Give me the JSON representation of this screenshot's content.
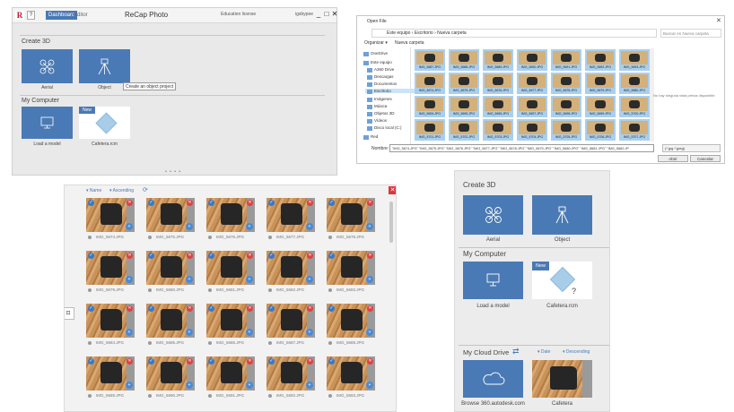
{
  "panel1": {
    "help_label": "?",
    "tabs": [
      "Dashboard",
      "Editor"
    ],
    "app_title": "ReCap Photo",
    "license": "Education license",
    "user": "igsbypee",
    "window_controls": [
      "_",
      "□",
      "✕"
    ],
    "create3d": {
      "heading": "Create 3D",
      "tiles": [
        {
          "label": "Aerial",
          "icon": "drone-icon"
        },
        {
          "label": "Object",
          "icon": "tripod-icon"
        }
      ],
      "tooltip": "Create an object project"
    },
    "mycomputer": {
      "heading": "My Computer",
      "tiles": [
        {
          "label": "Load a model",
          "icon": "monitor-icon"
        },
        {
          "label": "Cafetera.rcm",
          "badge": "New"
        }
      ]
    },
    "pager": "• • • •"
  },
  "panel2": {
    "title": "Open File",
    "address": "Este equipo  ›  Escritorio  ›  Nueva carpeta",
    "search_placeholder": "Buscar en Nueva carpeta",
    "toolbar": {
      "organize": "Organizar ▾",
      "new_folder": "Nueva carpeta"
    },
    "tree": [
      "OneDrive",
      "Este equipo",
      "A360 Drive",
      "Descargas",
      "Documentos",
      "Escritorio",
      "Imágenes",
      "Música",
      "Objetos 3D",
      "Vídeos",
      "Disco local (C:)",
      "Red"
    ],
    "files": [
      "IMG_5687.JPG",
      "IMG_5688.JPG",
      "IMG_5689.JPG",
      "IMG_5690.JPG",
      "IMG_5691.JPG",
      "IMG_5692.JPG",
      "IMG_5693.JPG",
      "IMG_5674.JPG",
      "IMG_5675.JPG",
      "IMG_5676.JPG",
      "IMG_5677.JPG",
      "IMG_5678.JPG",
      "IMG_5679.JPG",
      "IMG_5680.JPG",
      "IMG_5694.JPG",
      "IMG_5695.JPG",
      "IMG_5696.JPG",
      "IMG_5697.JPG",
      "IMG_5698.JPG",
      "IMG_5699.JPG",
      "IMG_5700.JPG",
      "IMG_5701.JPG",
      "IMG_5702.JPG",
      "IMG_5703.JPG",
      "IMG_5704.JPG",
      "IMG_5705.JPG",
      "IMG_5706.JPG",
      "IMG_5707.JPG"
    ],
    "preview_message": "No hay ninguna vista previa disponible.",
    "name_label": "Nombre:",
    "name_value": "\"IMG_5674.JPG\" \"IMG_5675.JPG\" \"IMG_5676.JPG\" \"IMG_5677.JPG\" \"IMG_5678.JPG\" \"IMG_5679.JPG\" \"IMG_5680.JPG\" \"IMG_5681.JPG\" \"IMG_5682.JP",
    "file_type": "(*.jpg *.jpeg)",
    "open_label": "Abrir",
    "cancel_label": "Cancelar"
  },
  "panel3": {
    "sort_by": "▾ Name",
    "sort_order": "▾ Ascending",
    "refresh_icon": "⟳",
    "close_label": "✕",
    "side_label": "⊡",
    "photos": [
      "IMG_5674.JPG",
      "IMG_5675.JPG",
      "IMG_5676.JPG",
      "IMG_5677.JPG",
      "IMG_5678.JPG",
      "IMG_5679.JPG",
      "IMG_5680.JPG",
      "IMG_5681.JPG",
      "IMG_5682.JPG",
      "IMG_5683.JPG",
      "IMG_5684.JPG",
      "IMG_5685.JPG",
      "IMG_5686.JPG",
      "IMG_5687.JPG",
      "IMG_5688.JPG",
      "IMG_5689.JPG",
      "IMG_5690.JPG",
      "IMG_5691.JPG",
      "IMG_5692.JPG",
      "IMG_5693.JPG"
    ],
    "check_glyph": "✓",
    "remove_glyph": "✕",
    "zoom_glyph": "🔍"
  },
  "panel4": {
    "create3d": {
      "heading": "Create 3D",
      "tiles": [
        "Aerial",
        "Object"
      ]
    },
    "mycomputer": {
      "heading": "My Computer",
      "tiles": [
        "Load a model",
        "Cafetera.rcm"
      ],
      "badge": "New",
      "cube_mark": "?"
    },
    "cloud": {
      "heading": "My Cloud Drive",
      "sync_icon": "⇄",
      "sort_by": "▾ Date",
      "sort_order": "▾ Descending",
      "tiles": [
        "Browse 360.autodesk.com",
        "Cafetera"
      ]
    }
  },
  "colors": {
    "accent_blue": "#4a7ab5",
    "close_red": "#d9363e",
    "selected_thumb": "#a9cfee"
  }
}
